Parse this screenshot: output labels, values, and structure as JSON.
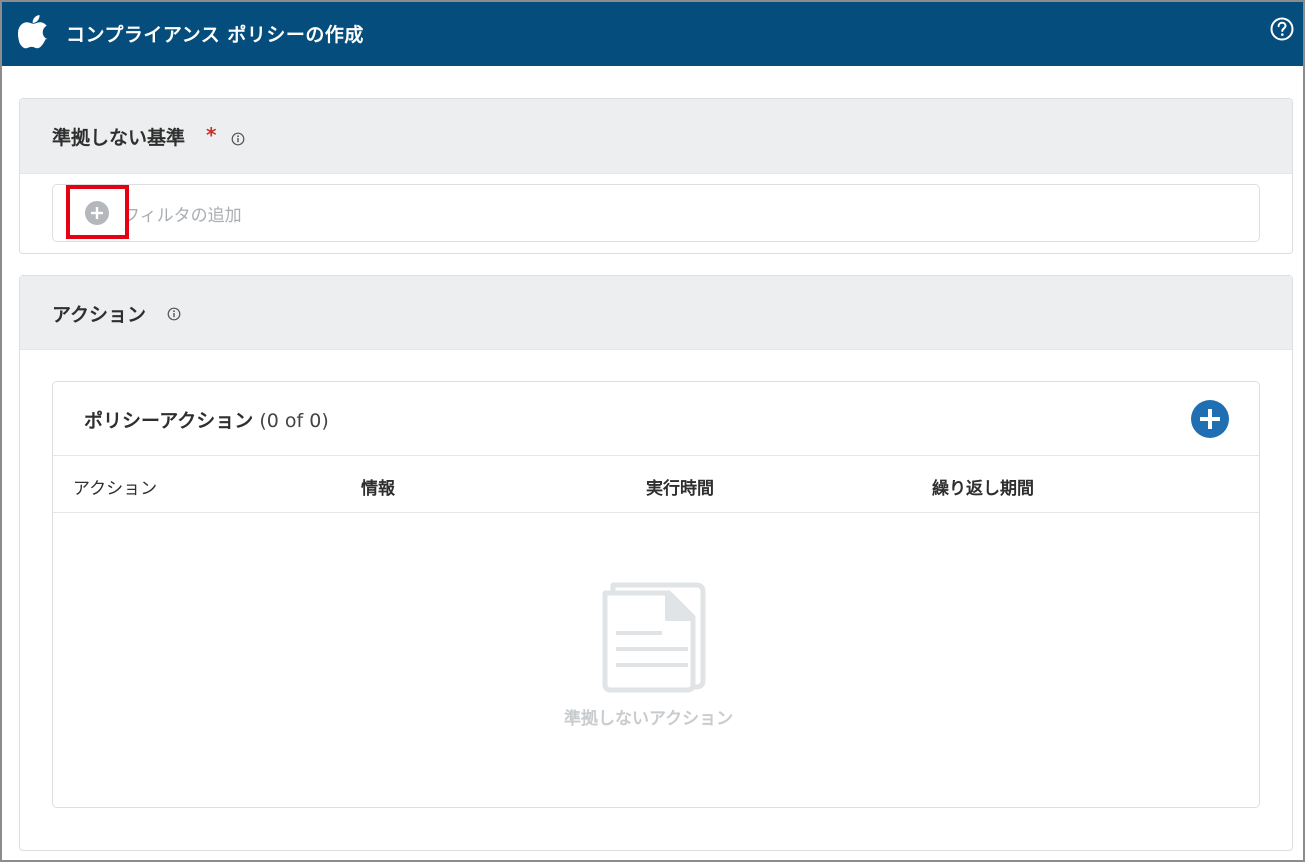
{
  "header": {
    "title": "コンプライアンス ポリシーの作成",
    "logo_icon": "apple-logo-icon",
    "help_icon": "help-question-icon"
  },
  "noncompliance_section": {
    "title": "準拠しない基準",
    "required_mark": "*",
    "info_icon": "info-icon",
    "add_filter_label": "フィルタの追加",
    "add_filter_icon": "plus-circle-icon"
  },
  "actions_section": {
    "title": "アクション",
    "info_icon": "info-icon",
    "panel": {
      "title": "ポリシーアクション",
      "count": "(0 of 0)",
      "add_icon": "plus-circle-icon",
      "columns": [
        "アクション",
        "情報",
        "実行時間",
        "繰り返し期間"
      ],
      "empty_text": "準拠しないアクション",
      "empty_icon": "document-icon"
    }
  },
  "colors": {
    "header_bg": "#054d7c",
    "accent_blue": "#1f6fb2",
    "highlight_red": "#e50012",
    "required_red": "#c9302c"
  }
}
